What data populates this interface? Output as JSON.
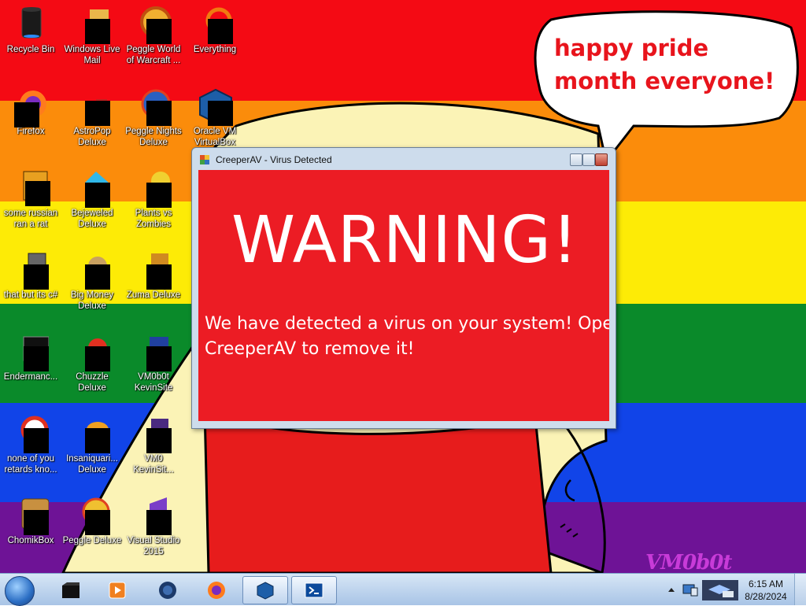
{
  "colors": {
    "red": "#f40a14",
    "orange": "#fb8c0b",
    "yellow": "#fdeb06",
    "green": "#0a8a2a",
    "blue": "#1144e8",
    "purple": "#6e1396",
    "dialog_red": "#ec1c24"
  },
  "bubble": {
    "text": "happy pride month everyone!"
  },
  "watermark": "VM0b0t",
  "desktop_icons": [
    {
      "label": "Recycle Bin",
      "icon": "recycle-bin-icon"
    },
    {
      "label": "Windows Live Mail",
      "icon": "mail-icon"
    },
    {
      "label": "Peggle World of Warcraft ...",
      "icon": "peggle-icon"
    },
    {
      "label": "Everything",
      "icon": "search-app-icon"
    },
    {
      "label": "Firefox",
      "icon": "firefox-icon"
    },
    {
      "label": "AstroPop Deluxe",
      "icon": "game-icon"
    },
    {
      "label": "Peggle Nights Deluxe",
      "icon": "peggle-icon"
    },
    {
      "label": "Oracle VM VirtualBox",
      "icon": "virtualbox-icon"
    },
    {
      "label": "some russian ran a rat",
      "icon": "app-icon"
    },
    {
      "label": "Bejeweled Deluxe",
      "icon": "gem-icon"
    },
    {
      "label": "Plants vs Zombies",
      "icon": "plant-icon"
    },
    {
      "label": "that but its c#",
      "icon": "app-icon"
    },
    {
      "label": "Big Money Deluxe",
      "icon": "money-icon"
    },
    {
      "label": "Zuma Deluxe",
      "icon": "zuma-icon"
    },
    {
      "label": "Endermanc...",
      "icon": "terminal-icon"
    },
    {
      "label": "Chuzzle Deluxe",
      "icon": "game-icon"
    },
    {
      "label": "VM0b0t KevinSite",
      "icon": "app-icon"
    },
    {
      "label": "none of you retards kno...",
      "icon": "app-icon"
    },
    {
      "label": "Insaniquari... Deluxe",
      "icon": "fish-icon"
    },
    {
      "label": "VM0 KevinSit...",
      "icon": "app-icon"
    },
    {
      "label": "ChomikBox",
      "icon": "chomikbox-icon"
    },
    {
      "label": "Peggle Deluxe",
      "icon": "peggle-icon"
    },
    {
      "label": "Visual Studio 2015",
      "icon": "visual-studio-icon"
    }
  ],
  "dialog": {
    "title": "CreeperAV - Virus Detected",
    "heading": "WARNING!",
    "message_line1": "We have detected a virus on your system! Open",
    "message_line2": "CreeperAV to remove it!"
  },
  "taskbar": {
    "items": [
      {
        "name": "taskbar-app-1",
        "icon": "black-box-icon"
      },
      {
        "name": "taskbar-media-player",
        "icon": "media-player-icon"
      },
      {
        "name": "taskbar-app-3",
        "icon": "globe-icon"
      },
      {
        "name": "taskbar-firefox",
        "icon": "firefox-icon"
      },
      {
        "name": "taskbar-virtualbox",
        "icon": "virtualbox-icon"
      },
      {
        "name": "taskbar-powershell",
        "icon": "powershell-icon"
      }
    ],
    "time": "6:15 AM",
    "date": "8/28/2024"
  }
}
